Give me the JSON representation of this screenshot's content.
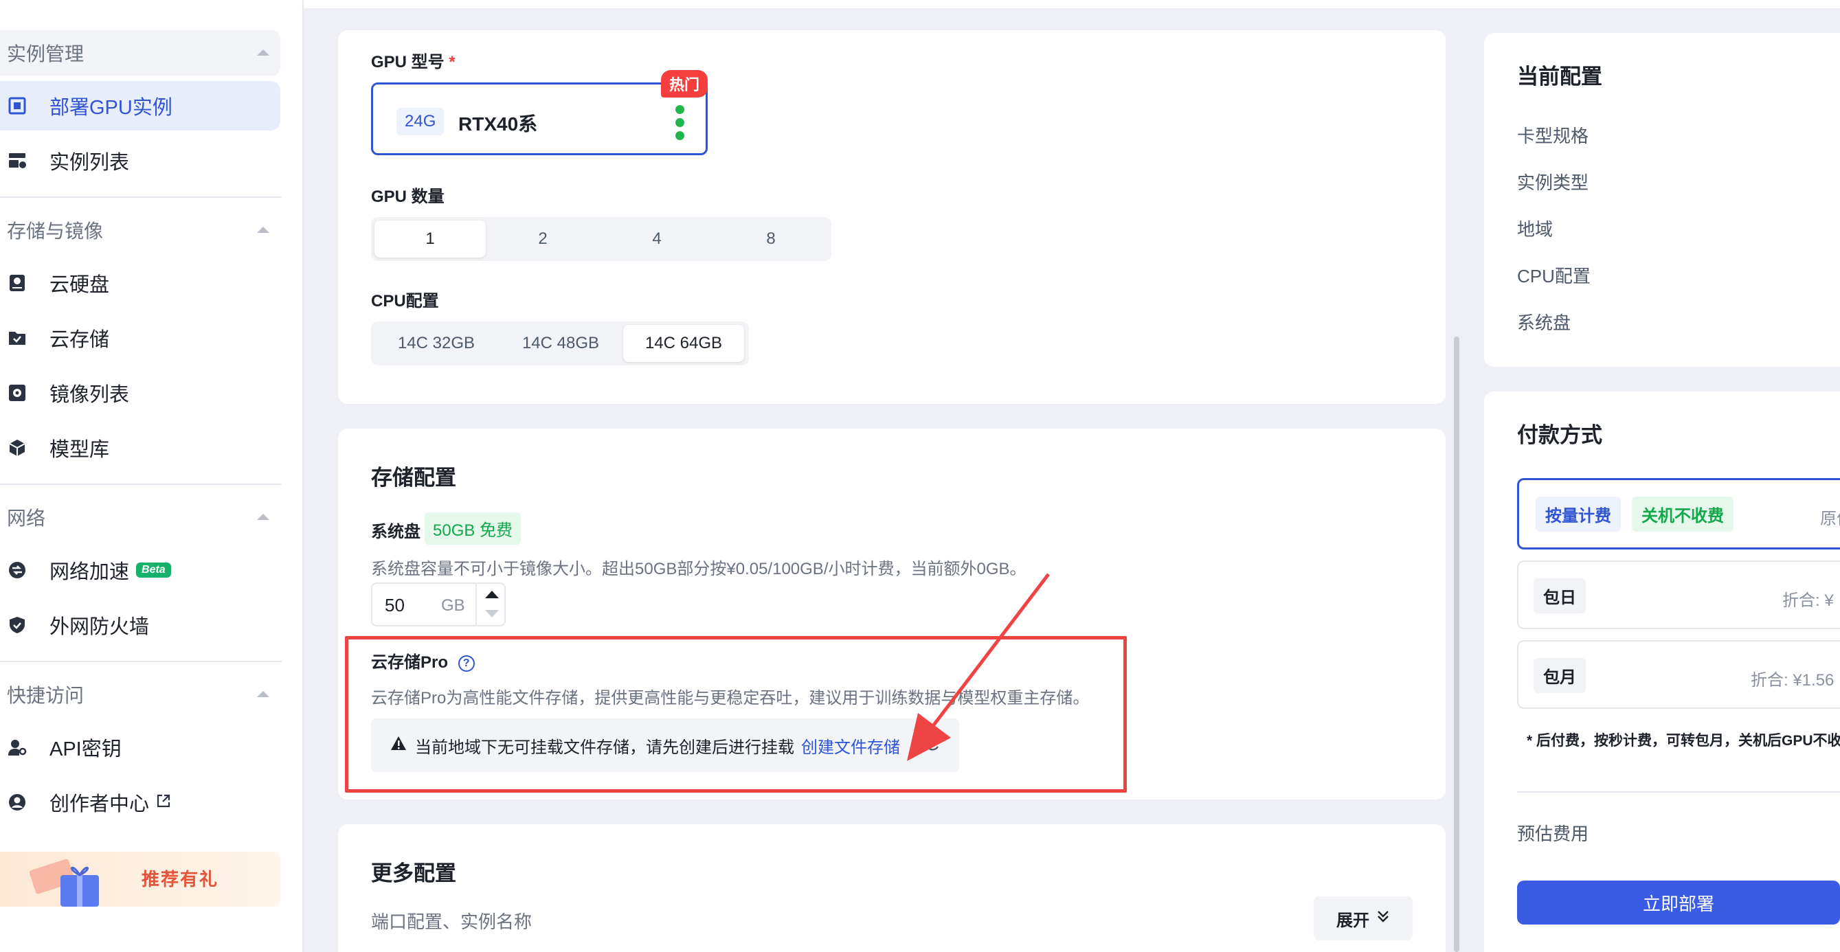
{
  "sidebar": {
    "sections": [
      {
        "title": "实例管理",
        "items": [
          "部署GPU实例",
          "实例列表"
        ]
      },
      {
        "title": "存储与镜像",
        "items": [
          "云硬盘",
          "云存储",
          "镜像列表",
          "模型库"
        ]
      },
      {
        "title": "网络",
        "items": [
          "网络加速",
          "外网防火墙"
        ]
      },
      {
        "title": "快捷访问",
        "items": [
          "API密钥",
          "创作者中心"
        ]
      }
    ],
    "beta_badge": "Beta",
    "promo_text": "推荐有礼"
  },
  "gpu": {
    "model_label": "GPU 型号",
    "required_mark": "*",
    "card_tag": "24G",
    "card_name": "RTX40系",
    "hot_badge": "热门",
    "count_label": "GPU 数量",
    "count_options": [
      "1",
      "2",
      "4",
      "8"
    ],
    "count_selected": "1",
    "cpu_label": "CPU配置",
    "cpu_options": [
      "14C 32GB",
      "14C 48GB",
      "14C 64GB"
    ],
    "cpu_selected": "14C 64GB"
  },
  "storage": {
    "title": "存储配置",
    "system_disk_label": "系统盘",
    "free_badge": "50GB 免费",
    "system_disk_desc": "系统盘容量不可小于镜像大小。超出50GB部分按¥0.05/100GB/小时计费，当前额外0GB。",
    "disk_value": "50",
    "disk_unit": "GB",
    "pro_label": "云存储Pro",
    "pro_desc": "云存储Pro为高性能文件存储，提供更高性能与更稳定吞吐，建议用于训练数据与模型权重主存储。",
    "alert_text": "当前地域下无可挂载文件存储，请先创建后进行挂载",
    "alert_link": "创建文件存储"
  },
  "more": {
    "title": "更多配置",
    "desc": "端口配置、实例名称",
    "expand_label": "展开"
  },
  "summary": {
    "title": "当前配置",
    "rows": [
      "卡型规格",
      "实例类型",
      "地域",
      "CPU配置",
      "系统盘"
    ]
  },
  "payment": {
    "title": "付款方式",
    "options": [
      {
        "tag": "按量计费",
        "extra": "关机不收费",
        "right": "原价"
      },
      {
        "tag": "包日",
        "right": "折合: ¥"
      },
      {
        "tag": "包月",
        "right": "折合: ¥1.56"
      }
    ],
    "note": "* 后付费，按秒计费，可转包月，关机后GPU不收费",
    "estimate_label": "预估费用",
    "deploy_label": "立即部署"
  },
  "colors": {
    "accent": "#2f55d4",
    "hot": "#f53f3f",
    "free": "#14a84b",
    "annotation": "#ef4444"
  }
}
